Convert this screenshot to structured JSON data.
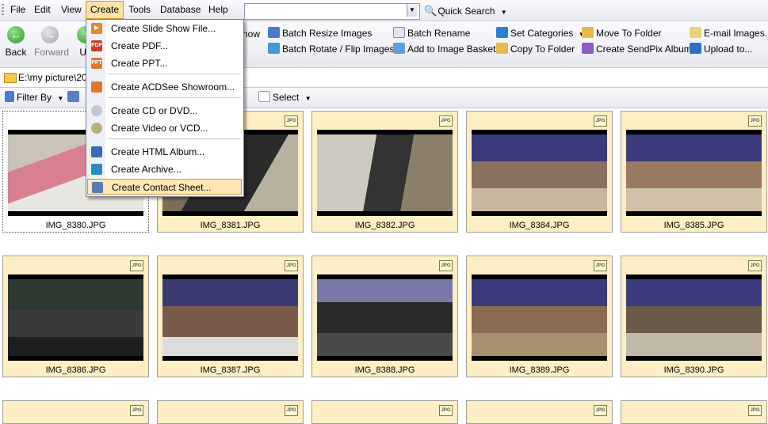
{
  "menubar": {
    "items": [
      "File",
      "Edit",
      "View",
      "Create",
      "Tools",
      "Database",
      "Help"
    ],
    "search_value": "",
    "quick_search": "Quick Search"
  },
  "toolbar": {
    "back": "Back",
    "forward": "Forward",
    "up": "Up",
    "show": "how",
    "batch_resize": "Batch Resize Images",
    "batch_rotate": "Batch Rotate / Flip Images",
    "batch_rename": "Batch Rename",
    "add_basket": "Add to Image Basket",
    "set_categories": "Set Categories",
    "copy_folder": "Copy To Folder",
    "move_folder": "Move To Folder",
    "create_sendpix": "Create SendPix Album",
    "email_images": "E-mail Images...",
    "upload": "Upload to..."
  },
  "path": {
    "text": "E:\\my picture\\200"
  },
  "filterbar": {
    "filter_by": "Filter By",
    "select": "Select"
  },
  "create_menu": {
    "items": [
      {
        "label": "Create Slide Show File...",
        "icon": "slideshow-icon"
      },
      {
        "label": "Create PDF...",
        "icon": "pdf-icon"
      },
      {
        "label": "Create PPT...",
        "icon": "ppt-icon"
      },
      {
        "label": "Create ACDSee Showroom...",
        "icon": "showroom-icon"
      },
      {
        "label": "Create CD or DVD...",
        "icon": "disc-icon"
      },
      {
        "label": "Create Video or VCD...",
        "icon": "video-icon"
      },
      {
        "label": "Create HTML Album...",
        "icon": "html-album-icon"
      },
      {
        "label": "Create Archive...",
        "icon": "archive-icon"
      },
      {
        "label": "Create Contact Sheet...",
        "icon": "contact-sheet-icon"
      }
    ]
  },
  "files": [
    "IMG_8380.JPG",
    "IMG_8381.JPG",
    "IMG_8382.JPG",
    "IMG_8384.JPG",
    "IMG_8385.JPG",
    "IMG_8386.JPG",
    "IMG_8387.JPG",
    "IMG_8388.JPG",
    "IMG_8389.JPG",
    "IMG_8390.JPG"
  ],
  "badge": "JPG",
  "colors": {
    "accent": "#fbe1a5",
    "tile_bg": "#fdeec4"
  }
}
